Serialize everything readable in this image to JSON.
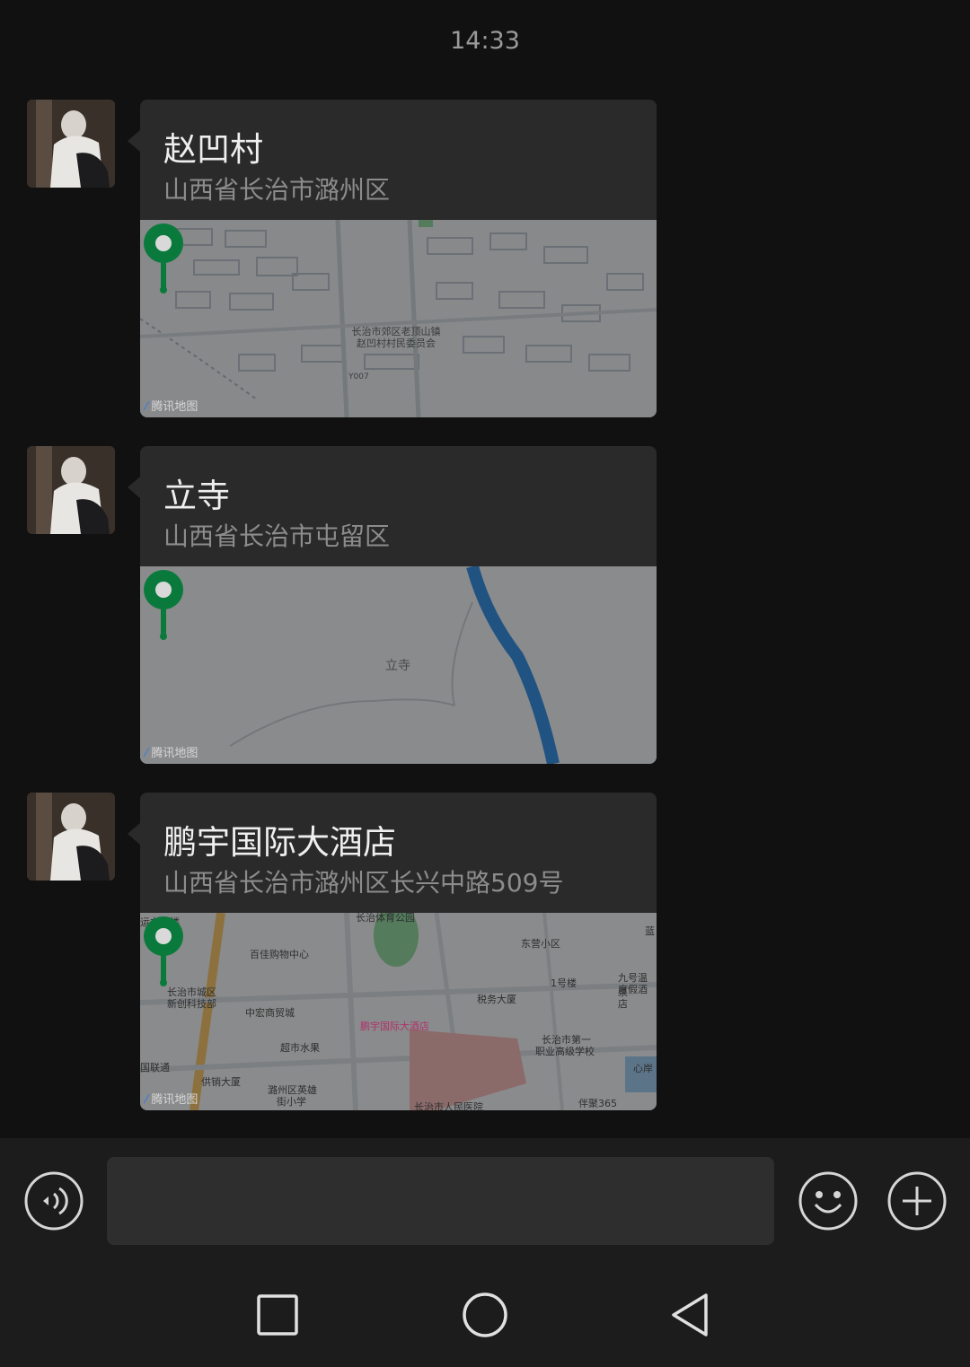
{
  "status": {
    "time": "14:33"
  },
  "messages": [
    {
      "title": "赵凹村",
      "address": "山西省长治市潞州区",
      "map_label_1": "长治市郊区老顶山镇",
      "map_label_2": "赵凹村村民委员会",
      "road_label": "Y007",
      "map_brand": "腾讯地图"
    },
    {
      "title": "立寺",
      "address": "山西省长治市屯留区",
      "map_label_1": "立寺",
      "map_brand": "腾讯地图"
    },
    {
      "title": "鹏宇国际大酒店",
      "address": "山西省长治市潞州区长兴中路509号",
      "map_label_1": "鹏宇国际大酒店",
      "poi": [
        "运办公楼",
        "长治体育公园",
        "百佳购物中心",
        "东营小区",
        "长治市城区",
        "新创科技部",
        "1号楼",
        "九号温泉",
        "度假酒店",
        "税务大厦",
        "中宏商贸城",
        "超市水果",
        "长治市第一",
        "职业高级学校",
        "国联通",
        "供销大厦",
        "潞州区英雄",
        "街小学",
        "长治市人民医院",
        "心岸",
        "伴聚365",
        "蓝"
      ],
      "map_brand": "腾讯地图"
    }
  ],
  "icons": {
    "voice": "voice-icon",
    "emoji": "emoji-icon",
    "plus": "plus-icon",
    "nav_recent": "square-icon",
    "nav_home": "circle-icon",
    "nav_back": "triangle-back-icon"
  },
  "colors": {
    "pin": "#0a7a3c",
    "background": "#111111",
    "bubble": "#2a2a2a"
  }
}
